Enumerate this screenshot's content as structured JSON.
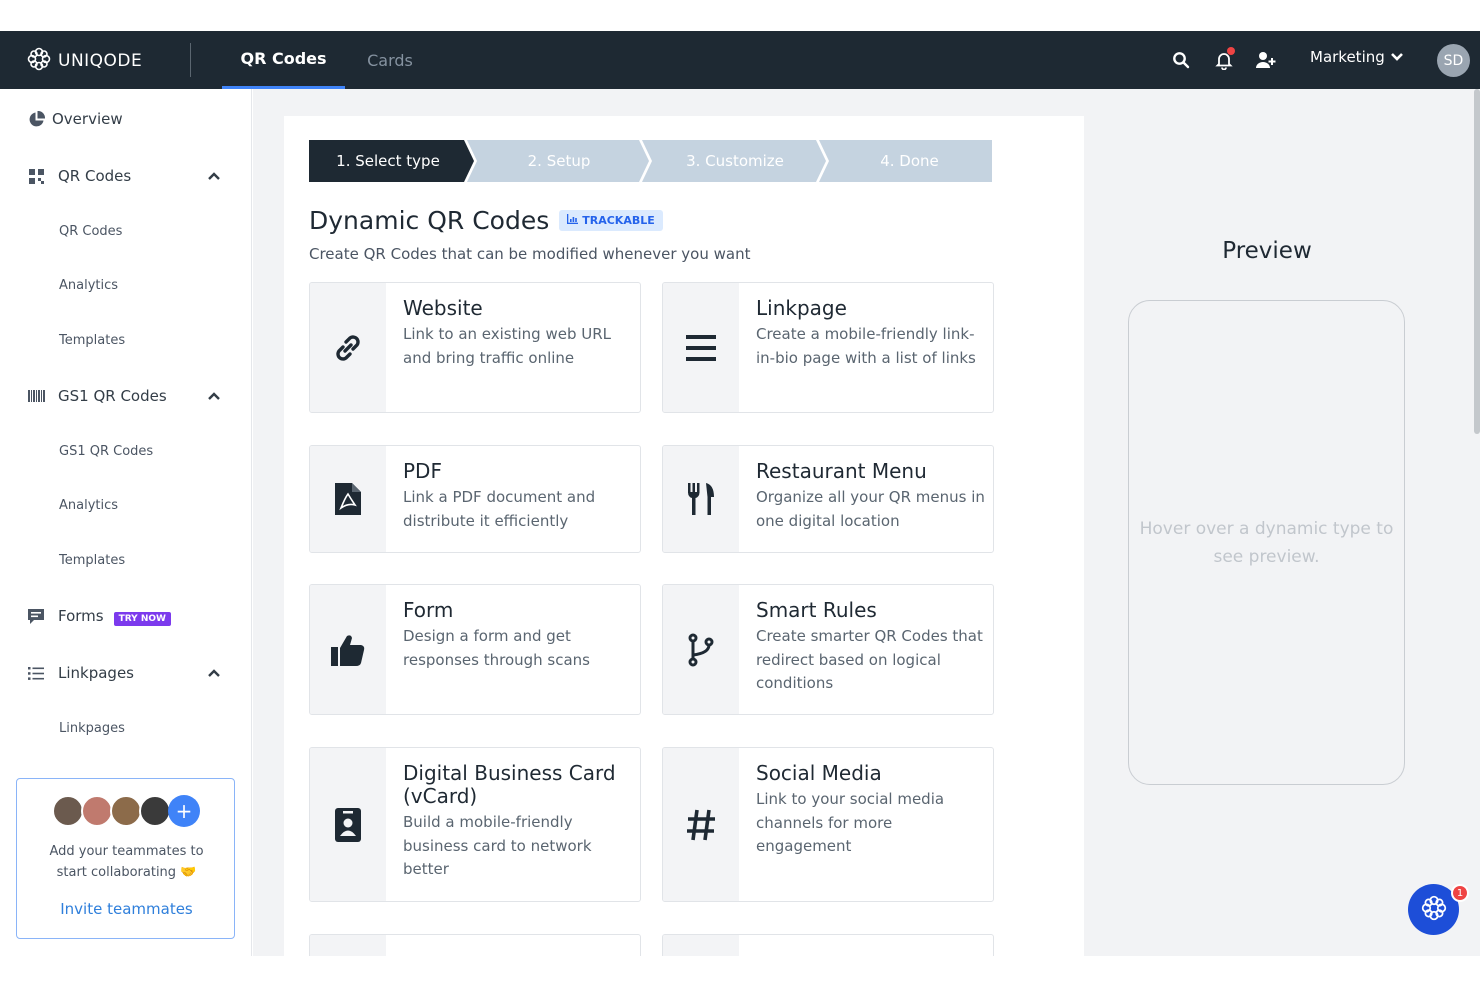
{
  "topbar": {
    "logo_text": "UNIQODE",
    "tabs": [
      {
        "label": "QR Codes",
        "active": true
      },
      {
        "label": "Cards",
        "active": false
      }
    ],
    "workspace": "Marketing",
    "avatar_initials": "SD",
    "icons": [
      "search-icon",
      "bell-icon",
      "add-user-icon",
      "chevron-down-icon"
    ]
  },
  "sidebar": {
    "overview": "Overview",
    "qr_codes": {
      "label": "QR Codes",
      "items": [
        "QR Codes",
        "Analytics",
        "Templates"
      ]
    },
    "gs1": {
      "label": "GS1 QR Codes",
      "items": [
        "GS1 QR Codes",
        "Analytics",
        "Templates"
      ]
    },
    "forms": {
      "label": "Forms",
      "badge": "TRY NOW"
    },
    "linkpages": {
      "label": "Linkpages",
      "items": [
        "Linkpages"
      ]
    }
  },
  "invite": {
    "text_line1": "Add your teammates to",
    "text_line2": "start collaborating 🤝",
    "link": "Invite teammates"
  },
  "stepper": {
    "steps": [
      "1. Select type",
      "2. Setup",
      "3. Customize",
      "4. Done"
    ],
    "active_index": 0
  },
  "header": {
    "title": "Dynamic QR Codes",
    "badge": "TRACKABLE",
    "subtitle": "Create QR Codes that can be modified whenever you want"
  },
  "types": [
    {
      "title": "Website",
      "desc": "Link to an existing web URL and bring traffic online",
      "icon": "link-icon"
    },
    {
      "title": "Linkpage",
      "desc": "Create a mobile-friendly link-in-bio page with a list of links",
      "icon": "list-icon"
    },
    {
      "title": "PDF",
      "desc": "Link a PDF document and distribute it efficiently",
      "icon": "pdf-icon"
    },
    {
      "title": "Restaurant Menu",
      "desc": "Organize all your QR menus in one digital location",
      "icon": "utensils-icon"
    },
    {
      "title": "Form",
      "desc": "Design a form and get responses through scans",
      "icon": "thumbs-up-icon"
    },
    {
      "title": "Smart Rules",
      "desc": "Create smarter QR Codes that redirect based on logical conditions",
      "icon": "branch-icon"
    },
    {
      "title": "Digital Business Card (vCard)",
      "desc": "Build a mobile-friendly business card to network better",
      "icon": "contact-card-icon"
    },
    {
      "title": "Social Media",
      "desc": "Link to your social media channels for more engagement",
      "icon": "hashtag-icon"
    }
  ],
  "preview": {
    "title": "Preview",
    "hint": "Hover over a dynamic type to see preview."
  },
  "chat": {
    "badge_count": "1"
  },
  "colors": {
    "topbar": "#1e2933",
    "accent": "#3f83f8",
    "step_active": "#1e2933",
    "step_inactive": "#c5d3e0"
  }
}
